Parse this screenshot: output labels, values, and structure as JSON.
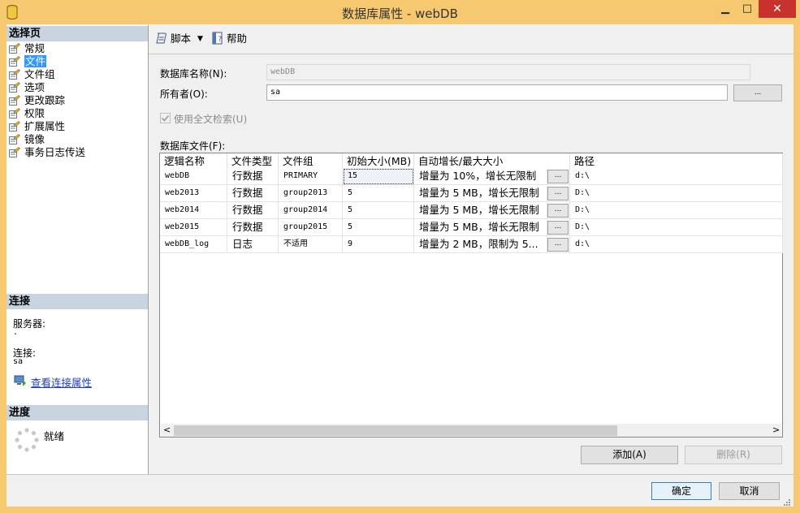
{
  "window": {
    "title": "数据库属性 - webDB",
    "minimize": "▁",
    "maximize": "□",
    "close": "✕"
  },
  "left": {
    "select_page_header": "选择页",
    "nav_items": [
      "常规",
      "文件",
      "文件组",
      "选项",
      "更改跟踪",
      "权限",
      "扩展属性",
      "镜像",
      "事务日志传送"
    ],
    "selected_index": 1,
    "connection_header": "连接",
    "server_label": "服务器:",
    "server_value": ".",
    "connection_label": "连接:",
    "connection_value": "sa",
    "view_connection_link": "查看连接属性",
    "progress_header": "进度",
    "progress_status": "就绪"
  },
  "toolbar": {
    "script_label": "脚本",
    "help_label": "帮助"
  },
  "form": {
    "dbname_label": "数据库名称(N):",
    "dbname_value": "webDB",
    "owner_label": "所有者(O):",
    "owner_value": "sa",
    "owner_browse": "...",
    "fulltext_label": "使用全文检索(U)",
    "fulltext_checked": true,
    "files_label": "数据库文件(F):"
  },
  "grid": {
    "columns": [
      "逻辑名称",
      "文件类型",
      "文件组",
      "初始大小(MB)",
      "自动增长/最大大小",
      "路径"
    ],
    "rows": [
      {
        "name": "webDB",
        "type": "行数据",
        "group": "PRIMARY",
        "size": "15",
        "growth": "增量为 10%，增长无限制",
        "path": "d:\\"
      },
      {
        "name": "web2013",
        "type": "行数据",
        "group": "group2013",
        "size": "5",
        "growth": "增量为 5 MB，增长无限制",
        "path": "D:\\"
      },
      {
        "name": "web2014",
        "type": "行数据",
        "group": "group2014",
        "size": "5",
        "growth": "增量为 5 MB，增长无限制",
        "path": "D:\\"
      },
      {
        "name": "web2015",
        "type": "行数据",
        "group": "group2015",
        "size": "5",
        "growth": "增量为 5 MB，增长无限制",
        "path": "D:\\"
      },
      {
        "name": "webDB_log",
        "type": "日志",
        "group": "不适用",
        "size": "9",
        "growth": "增量为 2 MB，限制为 5...",
        "path": "d:\\"
      }
    ],
    "ellipsis": "...",
    "scroll_left": "<",
    "scroll_right": ">"
  },
  "buttons": {
    "add": "添加(A)",
    "remove": "删除(R)",
    "ok": "确定",
    "cancel": "取消"
  }
}
